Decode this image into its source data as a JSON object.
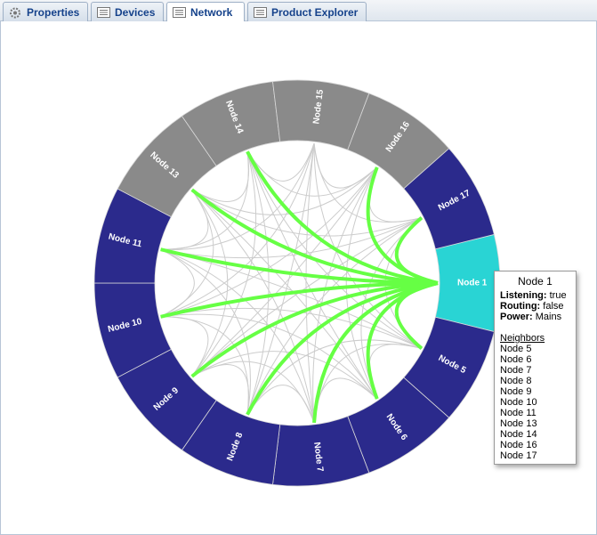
{
  "tabs": [
    {
      "label": "Properties",
      "icon": "gear-icon"
    },
    {
      "label": "Devices",
      "icon": "list-icon"
    },
    {
      "label": "Network",
      "icon": "list-icon"
    },
    {
      "label": "Product Explorer",
      "icon": "list-icon"
    }
  ],
  "active_tab": "Network",
  "nodes": [
    {
      "label": "Node 1",
      "color": "#29d4d4"
    },
    {
      "label": "Node 5",
      "color": "#2b2a8c"
    },
    {
      "label": "Node 6",
      "color": "#2b2a8c"
    },
    {
      "label": "Node 7",
      "color": "#2b2a8c"
    },
    {
      "label": "Node 8",
      "color": "#2b2a8c"
    },
    {
      "label": "Node 9",
      "color": "#2b2a8c"
    },
    {
      "label": "Node 10",
      "color": "#2b2a8c"
    },
    {
      "label": "Node 11",
      "color": "#2b2a8c"
    },
    {
      "label": "Node 13",
      "color": "#8a8a8a"
    },
    {
      "label": "Node 14",
      "color": "#8a8a8a"
    },
    {
      "label": "Node 15",
      "color": "#8a8a8a"
    },
    {
      "label": "Node 16",
      "color": "#8a8a8a"
    },
    {
      "label": "Node 17",
      "color": "#2b2a8c"
    }
  ],
  "link_colors": {
    "selected": "#66ff44",
    "other": "#cccccc"
  },
  "tooltip": {
    "title": "Node 1",
    "listening_label": "Listening:",
    "listening": "true",
    "routing_label": "Routing:",
    "routing": "false",
    "power_label": "Power:",
    "power": "Mains",
    "neighbors_label": "Neighbors",
    "neighbors": [
      "Node 5",
      "Node 6",
      "Node 7",
      "Node 8",
      "Node 9",
      "Node 10",
      "Node 11",
      "Node 13",
      "Node 14",
      "Node 16",
      "Node 17"
    ]
  }
}
